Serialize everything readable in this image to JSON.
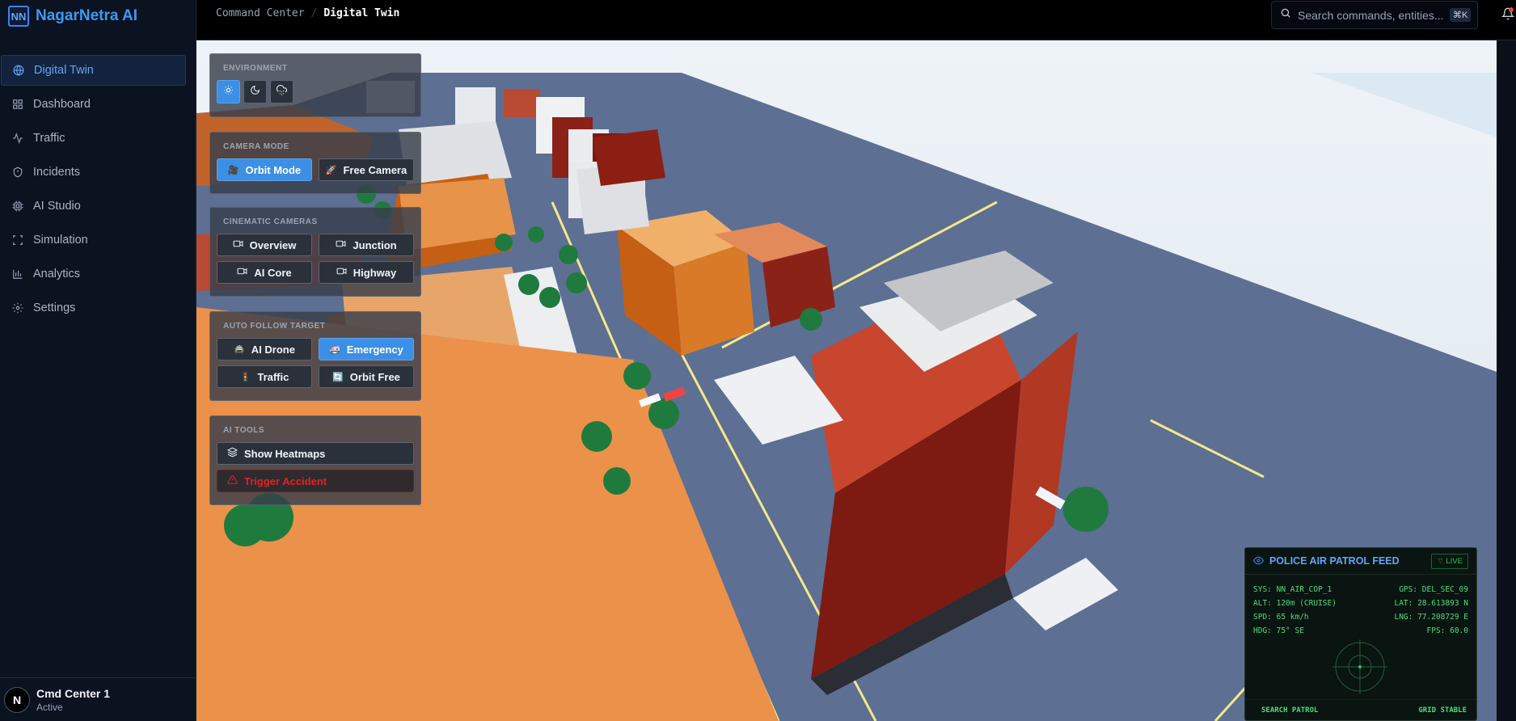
{
  "app": {
    "logo_text": "NN",
    "name": "NagarNetra AI"
  },
  "sidebar": {
    "items": [
      {
        "label": "Digital Twin",
        "icon": "globe-icon",
        "active": true
      },
      {
        "label": "Dashboard",
        "icon": "grid-icon"
      },
      {
        "label": "Traffic",
        "icon": "activity-icon"
      },
      {
        "label": "Incidents",
        "icon": "shield-icon"
      },
      {
        "label": "AI Studio",
        "icon": "cpu-icon"
      },
      {
        "label": "Simulation",
        "icon": "scan-icon"
      },
      {
        "label": "Analytics",
        "icon": "bar-chart-icon"
      },
      {
        "label": "Settings",
        "icon": "gear-icon"
      }
    ],
    "user": {
      "initial": "N",
      "name": "Cmd Center 1",
      "status": "Active"
    }
  },
  "topbar": {
    "breadcrumb": [
      "Command Center",
      "Digital Twin"
    ],
    "search_placeholder": "Search commands, entities...",
    "search_shortcut": "⌘K"
  },
  "panels": {
    "environment": {
      "title": "Environment",
      "modes": [
        {
          "icon": "sun-icon",
          "active": true
        },
        {
          "icon": "moon-icon",
          "active": false
        },
        {
          "icon": "cloud-rain-icon",
          "active": false
        }
      ]
    },
    "camera_mode": {
      "title": "Camera Mode",
      "buttons": [
        {
          "label": "Orbit Mode",
          "emoji": "🎥",
          "active": true
        },
        {
          "label": "Free Camera",
          "emoji": "🚀",
          "active": false
        }
      ]
    },
    "cinematic": {
      "title": "Cinematic Cameras",
      "buttons": [
        "Overview",
        "Junction",
        "AI Core",
        "Highway"
      ]
    },
    "follow": {
      "title": "Auto Follow Target",
      "buttons": [
        {
          "label": "AI Drone",
          "emoji": "🚔",
          "active": false
        },
        {
          "label": "Emergency",
          "emoji": "🚑",
          "active": true
        },
        {
          "label": "Traffic",
          "emoji": "🚦",
          "active": false
        },
        {
          "label": "Orbit Free",
          "emoji": "🔄",
          "active": false
        }
      ]
    },
    "ai_tools": {
      "title": "AI Tools",
      "heatmaps": "Show Heatmaps",
      "accident": "Trigger Accident"
    }
  },
  "feed": {
    "title": "POLICE AIR PATROL FEED",
    "live": "LIVE",
    "rows": [
      [
        "SYS: NN_AIR_COP_1",
        "GPS: DEL_SEC_09"
      ],
      [
        "ALT: 120m (CRUISE)",
        "LAT: 28.613893 N"
      ],
      [
        "SPD: 65 km/h",
        "LNG: 77.208729 E"
      ],
      [
        "HDG: 75° SE",
        "FPS: 60.0"
      ]
    ],
    "footer_left": "SEARCH PATROL",
    "footer_right": "GRID STABLE"
  },
  "colors": {
    "accent": "#3b8fe6",
    "brand": "#3b9bf2",
    "live": "#22c55e",
    "danger": "#dc2626"
  }
}
